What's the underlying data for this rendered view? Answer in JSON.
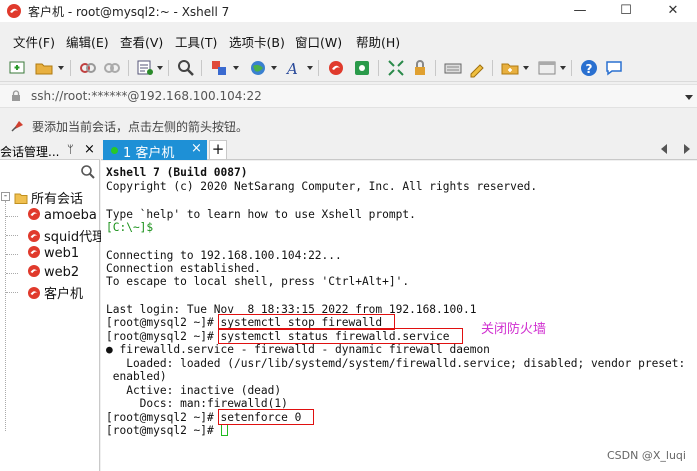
{
  "window": {
    "title": "客户机 - root@mysql2:~ - Xshell 7",
    "min": "—",
    "max": "☐",
    "close": "✕"
  },
  "menu": [
    "文件(F)",
    "编辑(E)",
    "查看(V)",
    "工具(T)",
    "选项卡(B)",
    "窗口(W)",
    "帮助(H)"
  ],
  "address": "ssh://root:******@192.168.100.104:22",
  "hint": "要添加当前会话，点击左侧的箭头按钮。",
  "session_panel": {
    "title": "会话管理...",
    "pin": "ᛘ",
    "close": "×",
    "expander": "-",
    "root": "所有会话",
    "items": [
      "amoeba",
      "squid代理",
      "web1",
      "web2",
      "客户机"
    ]
  },
  "tabs": {
    "active_label": "1 客户机",
    "close": "×",
    "add": "+"
  },
  "terminal": {
    "lines": [
      "Xshell 7 (Build 0087)",
      "Copyright (c) 2020 NetSarang Computer, Inc. All rights reserved.",
      "Type `help' to learn how to use Xshell prompt.",
      "[C:\\~]$",
      "Connecting to 192.168.100.104:22...",
      "Connection established.",
      "To escape to local shell, press 'Ctrl+Alt+]'.",
      "Last login: Tue Nov  8 18:33:15 2022 from 192.168.100.1",
      "[root@mysql2 ~]# systemctl stop firewalld",
      "[root@mysql2 ~]# systemctl status firewalld.service",
      "● firewalld.service - firewalld - dynamic firewall daemon",
      "   Loaded: loaded (/usr/lib/systemd/system/firewalld.service; disabled; vendor preset:",
      " enabled)",
      "   Active: inactive (dead)",
      "     Docs: man:firewalld(1)",
      "[root@mysql2 ~]# setenforce 0",
      "[root@mysql2 ~]# "
    ],
    "annotation": "关闭防火墙"
  },
  "watermark": "CSDN @X_luqi",
  "colors": {
    "tab_active": "#1e90d6",
    "annotation_box": "#e01010",
    "annotation_text": "#d030d0",
    "prompt_green": "#189018"
  }
}
